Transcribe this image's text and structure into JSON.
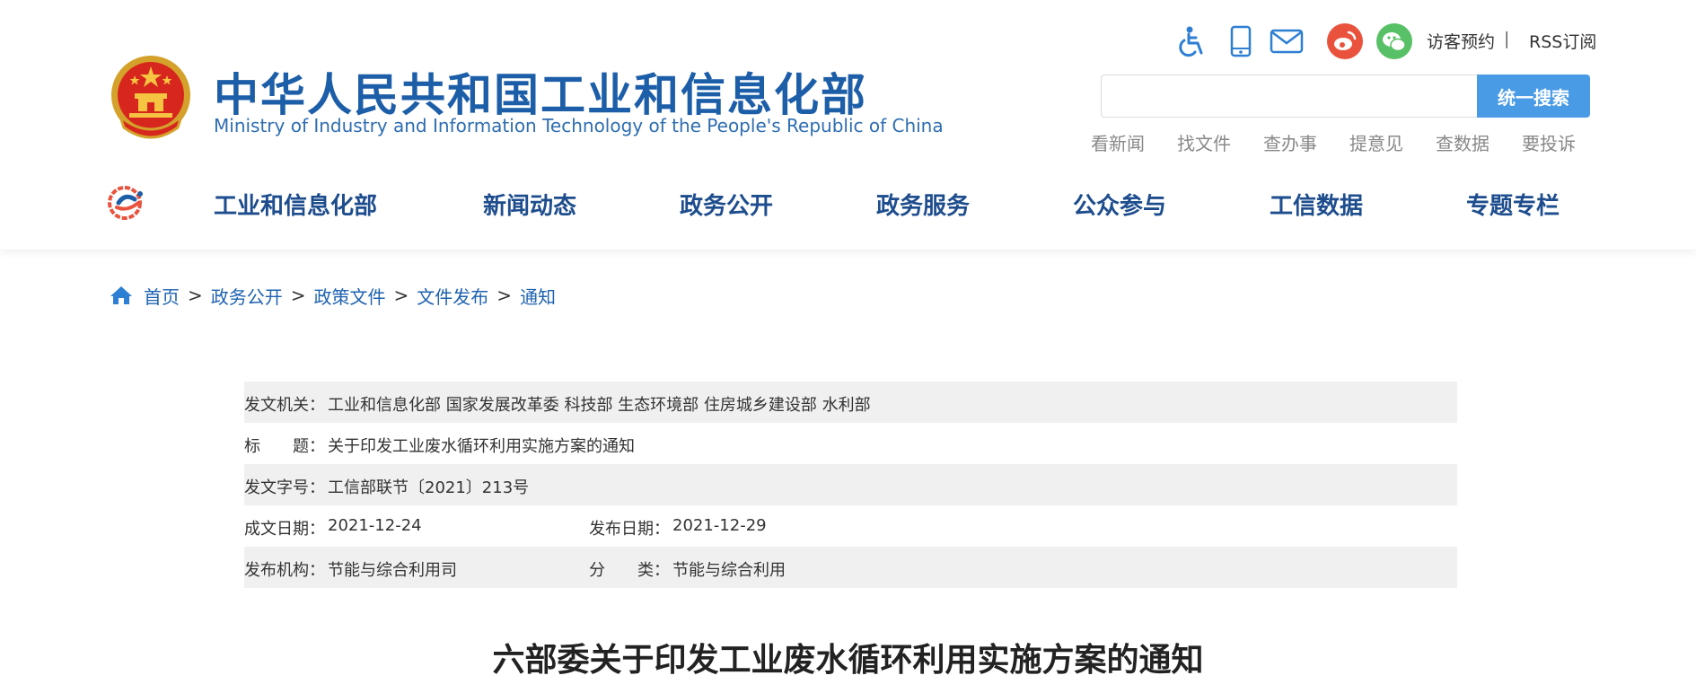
{
  "header": {
    "title": "中华人民共和国工业和信息化部",
    "subtitle": "Ministry of Industry and Information Technology of the People's Republic of China"
  },
  "utility": {
    "icons": [
      "accessibility-icon",
      "mobile-icon",
      "mail-icon",
      "weibo-icon",
      "wechat-icon"
    ],
    "visitor_link": "访客预约",
    "separator": "|",
    "rss_link": "RSS订阅"
  },
  "search": {
    "placeholder": "",
    "value": "",
    "button": "统一搜索"
  },
  "quick_links": [
    "看新闻",
    "找文件",
    "查办事",
    "提意见",
    "查数据",
    "要投诉"
  ],
  "nav": [
    "工业和信息化部",
    "新闻动态",
    "政务公开",
    "政务服务",
    "公众参与",
    "工信数据",
    "专题专栏"
  ],
  "breadcrumb": [
    "首页",
    "政务公开",
    "政策文件",
    "文件发布",
    "通知"
  ],
  "breadcrumb_sep": ">",
  "meta": {
    "issuer_label": "发文机关：",
    "issuer": "工业和信息化部 国家发展改革委 科技部 生态环境部 住房城乡建设部 水利部",
    "title_label": "标　　题：",
    "title": "关于印发工业废水循环利用实施方案的通知",
    "number_label": "发文字号：",
    "number": "工信部联节〔2021〕213号",
    "created_label": "成文日期：",
    "created": "2021-12-24",
    "published_label": "发布日期：",
    "published": "2021-12-29",
    "agency_label": "发布机构：",
    "agency": "节能与综合利用司",
    "category_label": "分　　类：",
    "category": "节能与综合利用"
  },
  "document_title": "六部委关于印发工业废水循环利用实施方案的通知",
  "colors": {
    "brand_blue": "#1d5ea8",
    "nav_blue": "#1e4d8e",
    "link_blue": "#1e62b0",
    "search_button": "#4a9be6",
    "row_gray": "#f0f0f0",
    "weibo": "#e9533d",
    "wechat": "#58c066"
  }
}
